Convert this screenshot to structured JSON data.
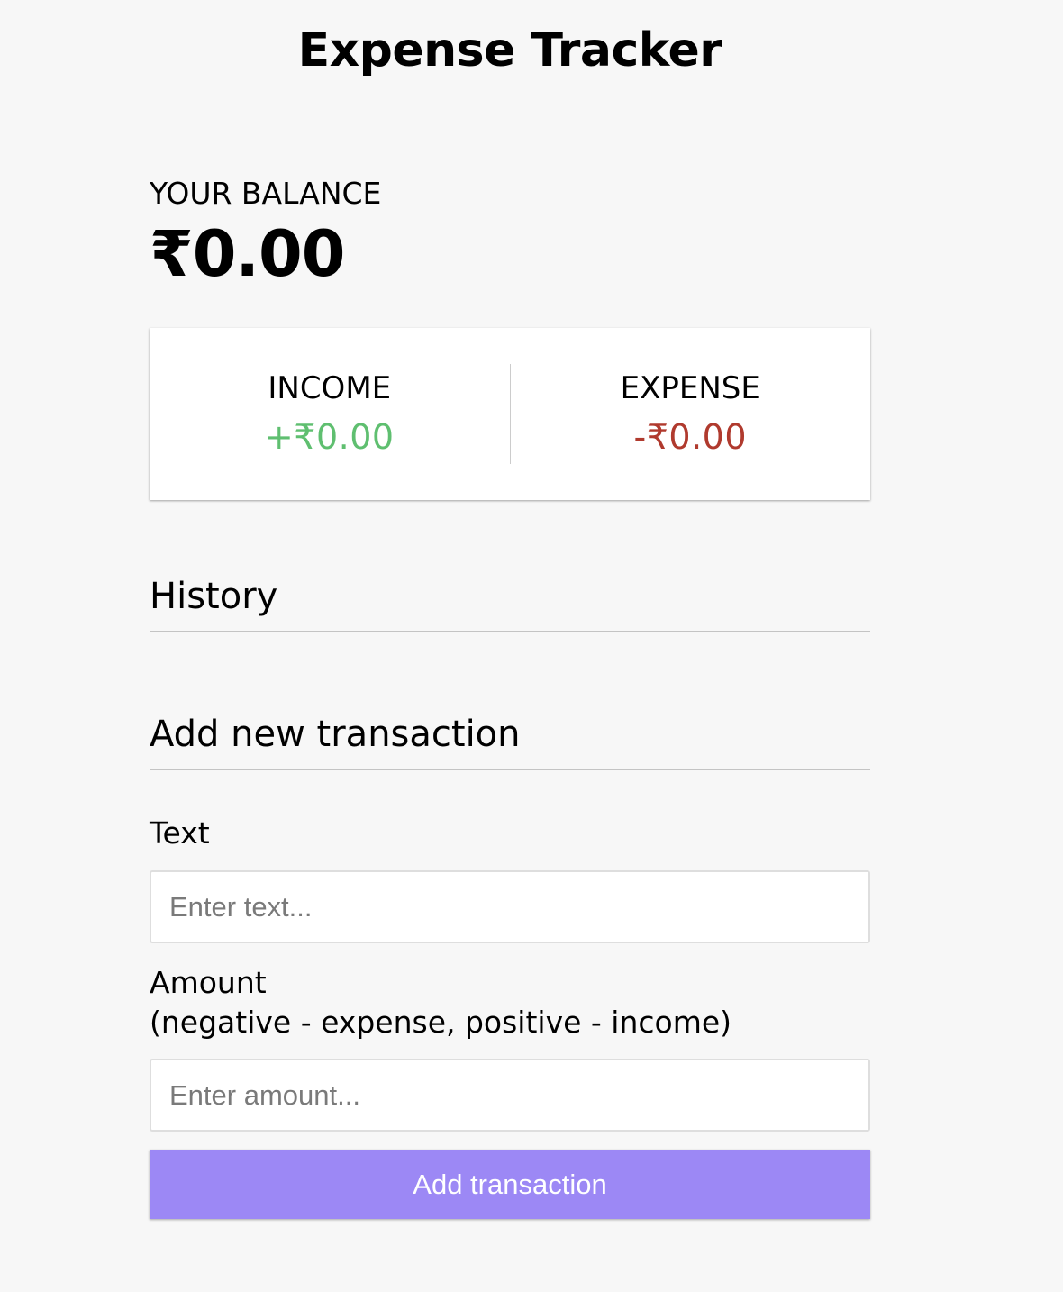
{
  "header": {
    "title": "Expense Tracker"
  },
  "balance": {
    "label": "YOUR BALANCE",
    "value": "₹0.00"
  },
  "summary": {
    "income_label": "INCOME",
    "income_value": "+₹0.00",
    "expense_label": "EXPENSE",
    "expense_value": "-₹0.00"
  },
  "history": {
    "heading": "History"
  },
  "form": {
    "heading": "Add new transaction",
    "text_label": "Text",
    "text_placeholder": "Enter text...",
    "amount_label_line1": "Amount",
    "amount_label_line2": "(negative - expense, positive - income)",
    "amount_placeholder": "Enter amount...",
    "submit_label": "Add transaction"
  },
  "colors": {
    "background": "#f7f7f7",
    "income": "#5fbf70",
    "expense": "#b03a2e",
    "button": "#9c88f5"
  }
}
